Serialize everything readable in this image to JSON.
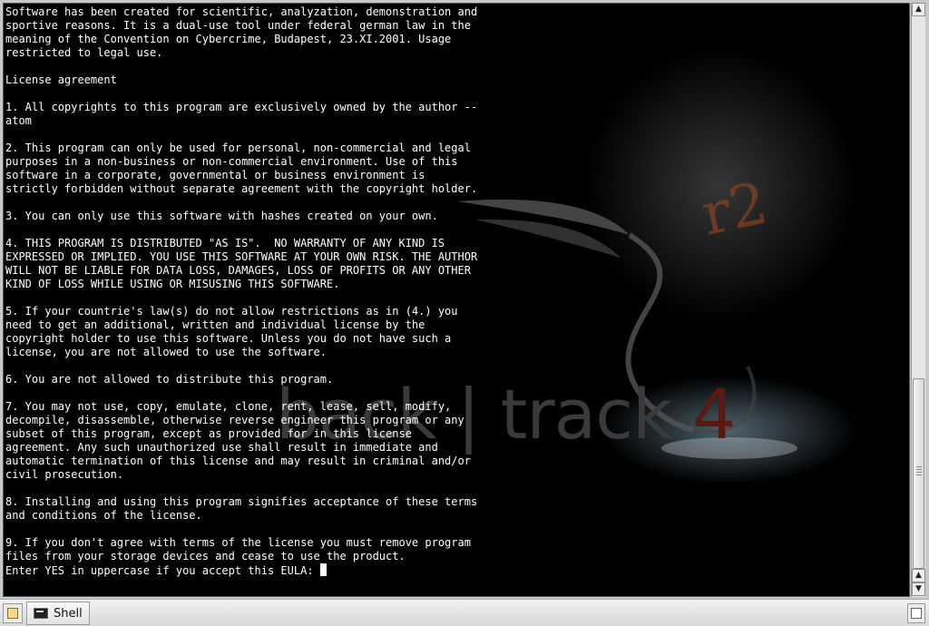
{
  "terminal": {
    "lines": [
      "Software has been created for scientific, analyzation, demonstration and",
      "sportive reasons. It is a dual-use tool under federal german law in the",
      "meaning of the Convention on Cybercrime, Budapest, 23.XI.2001. Usage",
      "restricted to legal use.",
      "",
      "License agreement",
      "",
      "1. All copyrights to this program are exclusively owned by the author --",
      "atom",
      "",
      "2. This program can only be used for personal, non-commercial and legal",
      "purposes in a non-business or non-commercial environment. Use of this",
      "software in a corporate, governmental or business environment is",
      "strictly forbidden without separate agreement with the copyright holder.",
      "",
      "3. You can only use this software with hashes created on your own.",
      "",
      "4. THIS PROGRAM IS DISTRIBUTED \"AS IS\".  NO WARRANTY OF ANY KIND IS",
      "EXPRESSED OR IMPLIED. YOU USE THIS SOFTWARE AT YOUR OWN RISK. THE AUTHOR",
      "WILL NOT BE LIABLE FOR DATA LOSS, DAMAGES, LOSS OF PROFITS OR ANY OTHER",
      "KIND OF LOSS WHILE USING OR MISUSING THIS SOFTWARE.",
      "",
      "5. If your countrie's law(s) do not allow restrictions as in (4.) you",
      "need to get an additional, written and individual license by the",
      "copyright holder to use this software. Unless you do not have such a",
      "license, you are not allowed to use the software.",
      "",
      "6. You are not allowed to distribute this program.",
      "",
      "7. You may not use, copy, emulate, clone, rent, lease, sell, modify,",
      "decompile, disassemble, otherwise reverse engineer this program or any",
      "subset of this program, except as provided for in this license",
      "agreement. Any such unauthorized use shall result in immediate and",
      "automatic termination of this license and may result in criminal and/or",
      "civil prosecution.",
      "",
      "8. Installing and using this program signifies acceptance of these terms",
      "and conditions of the license.",
      "",
      "9. If you don't agree with terms of the license you must remove program",
      "files from your storage devices and cease to use the product.",
      ""
    ],
    "prompt": "Enter YES in uppercase if you accept this EULA: ",
    "input_value": ""
  },
  "wallpaper": {
    "logo_text_a": "back",
    "logo_sep": "|",
    "logo_text_b": "track",
    "logo_version": "4",
    "watermark": "r2"
  },
  "taskbar": {
    "tasks": [
      {
        "label": "Shell",
        "icon": "terminal-icon"
      }
    ]
  },
  "colors": {
    "terminal_bg": "#000000",
    "terminal_fg": "#ffffff",
    "accent": "#5a1a12"
  },
  "icons": {
    "scroll_up": "chevron-up-icon",
    "scroll_down": "chevron-down-icon",
    "desktop": "show-desktop-icon",
    "window_list": "window-list-icon"
  }
}
